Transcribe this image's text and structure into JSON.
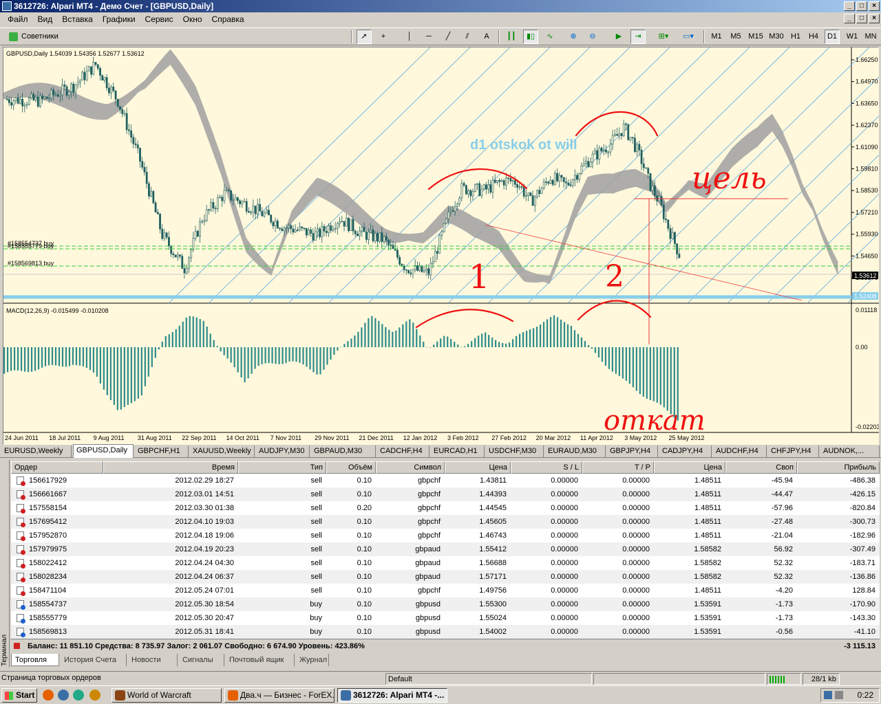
{
  "window": {
    "title": "3612726: Alpari MT4 - Демо Счет - [GBPUSD,Daily]"
  },
  "menu": [
    "Файл",
    "Вид",
    "Вставка",
    "Графики",
    "Сервис",
    "Окно",
    "Справка"
  ],
  "toolbar": {
    "experts_label": "Советники",
    "timeframes": [
      "M1",
      "M5",
      "M15",
      "M30",
      "H1",
      "H4",
      "D1",
      "W1",
      "MN"
    ],
    "active_timeframe": "D1"
  },
  "chart": {
    "header": "GBPUSD,Daily  1.54039 1.54356 1.52677 1.53612",
    "annotation": "d1 otskok ot will",
    "price_ticks": [
      "1.66250",
      "1.64970",
      "1.63650",
      "1.62370",
      "1.61090",
      "1.59810",
      "1.58530",
      "1.57210",
      "1.55930",
      "1.54650",
      "1.53370"
    ],
    "current_price": "1.53612",
    "level_price": "1.52408",
    "order_lines": [
      "#158554737 buy",
      "#158555779 buy",
      "#158569813 buy"
    ],
    "macd_header": "MACD(12,26,9) -0.015499 -0.010208",
    "macd_ticks": [
      "0.01118",
      "0.00",
      "-0.02203"
    ],
    "date_ticks": [
      "24 Jun 2011",
      "18 Jul 2011",
      "9 Aug 2011",
      "31 Aug 2011",
      "22 Sep 2011",
      "14 Oct 2011",
      "7 Nov 2011",
      "29 Nov 2011",
      "21 Dec 2011",
      "12 Jan 2012",
      "3 Feb 2012",
      "27 Feb 2012",
      "20 Mar 2012",
      "11 Apr 2012",
      "3 May 2012",
      "25 May 2012"
    ],
    "handwritten": {
      "n1": "1",
      "n2": "2",
      "target": "цель",
      "pullback": "откат"
    }
  },
  "chart_tabs": [
    "EURUSD,Weekly",
    "GBPUSD,Daily",
    "GBPCHF,H1",
    "XAUUSD,Weekly",
    "AUDJPY,M30",
    "GBPAUD,M30",
    "CADCHF,H4",
    "EURCAD,H1",
    "USDCHF,M30",
    "EURAUD,M30",
    "GBPJPY,H4",
    "CADJPY,H4",
    "AUDCHF,H4",
    "CHFJPY,H4",
    "AUDNOK,..."
  ],
  "active_chart_tab": "GBPUSD,Daily",
  "terminal": {
    "side_label": "Терминал",
    "columns": [
      "Ордер",
      "Время",
      "Тип",
      "Объём",
      "Символ",
      "Цена",
      "S / L",
      "T / P",
      "Цена",
      "Своп",
      "Прибыль"
    ],
    "orders": [
      [
        "156617929",
        "2012.02.29 18:27",
        "sell",
        "0.10",
        "gbpchf",
        "1.43811",
        "0.00000",
        "0.00000",
        "1.48511",
        "-45.94",
        "-486.38"
      ],
      [
        "156661667",
        "2012.03.01 14:51",
        "sell",
        "0.10",
        "gbpchf",
        "1.44393",
        "0.00000",
        "0.00000",
        "1.48511",
        "-44.47",
        "-426.15"
      ],
      [
        "157558154",
        "2012.03.30 01:38",
        "sell",
        "0.20",
        "gbpchf",
        "1.44545",
        "0.00000",
        "0.00000",
        "1.48511",
        "-57.96",
        "-820.84"
      ],
      [
        "157695412",
        "2012.04.10 19:03",
        "sell",
        "0.10",
        "gbpchf",
        "1.45605",
        "0.00000",
        "0.00000",
        "1.48511",
        "-27.48",
        "-300.73"
      ],
      [
        "157952870",
        "2012.04.18 19:06",
        "sell",
        "0.10",
        "gbpchf",
        "1.46743",
        "0.00000",
        "0.00000",
        "1.48511",
        "-21.04",
        "-182.96"
      ],
      [
        "157979975",
        "2012.04.19 20:23",
        "sell",
        "0.10",
        "gbpaud",
        "1.55412",
        "0.00000",
        "0.00000",
        "1.58582",
        "56.92",
        "-307.49"
      ],
      [
        "158022412",
        "2012.04.24 04:30",
        "sell",
        "0.10",
        "gbpaud",
        "1.56688",
        "0.00000",
        "0.00000",
        "1.58582",
        "52.32",
        "-183.71"
      ],
      [
        "158028234",
        "2012.04.24 06:37",
        "sell",
        "0.10",
        "gbpaud",
        "1.57171",
        "0.00000",
        "0.00000",
        "1.58582",
        "52.32",
        "-136.86"
      ],
      [
        "158471104",
        "2012.05.24 07:01",
        "sell",
        "0.10",
        "gbpchf",
        "1.49756",
        "0.00000",
        "0.00000",
        "1.48511",
        "-4.20",
        "128.84"
      ],
      [
        "158554737",
        "2012.05.30 18:54",
        "buy",
        "0.10",
        "gbpusd",
        "1.55300",
        "0.00000",
        "0.00000",
        "1.53591",
        "-1.73",
        "-170.90"
      ],
      [
        "158555779",
        "2012.05.30 20:47",
        "buy",
        "0.10",
        "gbpusd",
        "1.55024",
        "0.00000",
        "0.00000",
        "1.53591",
        "-1.73",
        "-143.30"
      ],
      [
        "158569813",
        "2012.05.31 18:41",
        "buy",
        "0.10",
        "gbpusd",
        "1.54002",
        "0.00000",
        "0.00000",
        "1.53591",
        "-0.56",
        "-41.10"
      ]
    ],
    "balance_line": "Баланс: 11 851.10  Средства: 8 735.97  Залог: 2 061.07  Свободно: 6 674.90  Уровень: 423.86%",
    "total_profit": "-3 115.13",
    "tabs": [
      "Торговля",
      "История Счета",
      "Новости",
      "Сигналы",
      "Почтовый ящик",
      "Журнал"
    ],
    "active_tab": "Торговля"
  },
  "status": {
    "left": "Страница торговых ордеров",
    "profile": "Default",
    "traffic": "28/1 kb"
  },
  "taskbar": {
    "start": "Start",
    "tasks": [
      "World of Warcraft",
      "Два.ч — Бизнес - ForEX...",
      "3612726: Alpari MT4 -..."
    ],
    "clock": "0:22"
  },
  "colors": {
    "chart_bg": "#fff8dc",
    "cloud": "#a0a0a0",
    "candle": "#1f5f5f",
    "macd": "#2e8b8b",
    "annotation": "#87ceeb",
    "handwriting": "#ee1111",
    "level": "#87ceeb"
  }
}
